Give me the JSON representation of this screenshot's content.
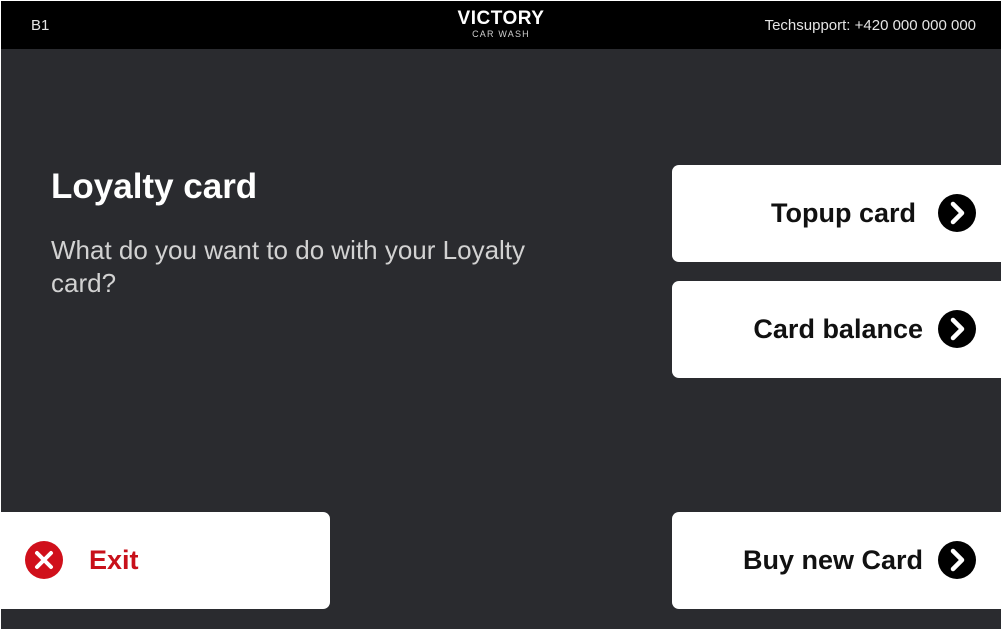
{
  "header": {
    "station": "B1",
    "logo_main": "VICTORY",
    "logo_sub": "CAR WASH",
    "techsupport": "Techsupport: +420 000 000 000"
  },
  "main": {
    "title": "Loyalty card",
    "subtitle": "What do you want to do with your Loyalty card?"
  },
  "actions": {
    "topup": "Topup card",
    "balance": "Card balance",
    "buy": "Buy new Card",
    "exit": "Exit"
  },
  "icons": {
    "chevron": "chevron-right-circle-icon",
    "exit": "close-circle-icon"
  },
  "colors": {
    "background": "#2a2b2f",
    "topbar": "#000000",
    "exit_red": "#c8101a"
  }
}
